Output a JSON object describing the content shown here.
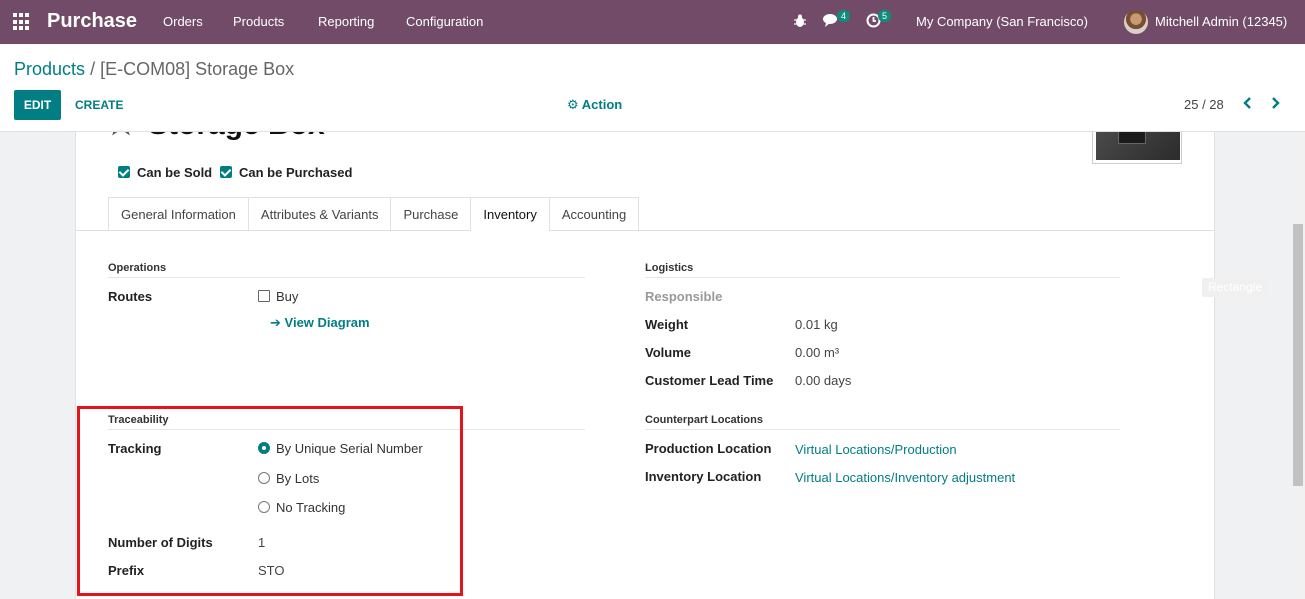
{
  "navbar": {
    "app_name": "Purchase",
    "menu": [
      "Orders",
      "Products",
      "Reporting",
      "Configuration"
    ],
    "messages_count": "4",
    "activities_count": "5",
    "company": "My Company (San Francisco)",
    "user": "Mitchell Admin (12345)",
    "bg_color": "#714b67"
  },
  "breadcrumb": {
    "parent": "Products",
    "separator": "/",
    "current": "[E-COM08] Storage Box"
  },
  "toolbar": {
    "edit_label": "EDIT",
    "create_label": "CREATE",
    "action_label": "Action",
    "pager": "25 / 28"
  },
  "product": {
    "name": "Storage Box",
    "can_be_sold_label": "Can be Sold",
    "can_be_purchased_label": "Can be Purchased"
  },
  "tabs": [
    "General Information",
    "Attributes & Variants",
    "Purchase",
    "Inventory",
    "Accounting"
  ],
  "active_tab": "Inventory",
  "operations": {
    "title": "Operations",
    "routes_label": "Routes",
    "route_option": "Buy",
    "view_diagram": "View Diagram"
  },
  "logistics": {
    "title": "Logistics",
    "responsible_label": "Responsible",
    "weight_label": "Weight",
    "weight_value": "0.01",
    "weight_unit": "kg",
    "volume_label": "Volume",
    "volume_value": "0.00",
    "volume_unit": "m³",
    "lead_time_label": "Customer Lead Time",
    "lead_time_value": "0.00 days"
  },
  "traceability": {
    "title": "Traceability",
    "tracking_label": "Tracking",
    "options": [
      "By Unique Serial Number",
      "By Lots",
      "No Tracking"
    ],
    "selected": "By Unique Serial Number",
    "digits_label": "Number of Digits",
    "digits_value": "1",
    "prefix_label": "Prefix",
    "prefix_value": "STO"
  },
  "counterpart": {
    "title": "Counterpart Locations",
    "production_label": "Production Location",
    "production_value": "Virtual Locations/Production",
    "inventory_label": "Inventory Location",
    "inventory_value": "Virtual Locations/Inventory adjustment"
  },
  "overlay": {
    "tooltip": "Rectangle",
    "highlight_color": "#e5131a"
  },
  "accent_color": "#017e84"
}
